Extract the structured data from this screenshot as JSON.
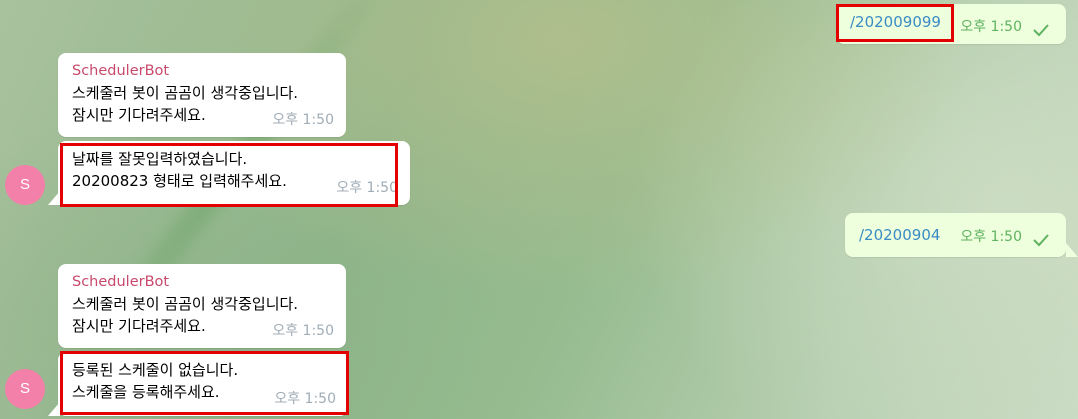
{
  "messages": [
    {
      "text": "/202009099",
      "time": "오후 1:50"
    },
    {
      "sender": "SchedulerBot",
      "text": "스케줄러 봇이 곰곰이 생각중입니다.\n잠시만 기다려주세요.",
      "time": "오후 1:50"
    },
    {
      "text": "날짜를 잘못입력하였습니다.\n20200823 형태로 입력해주세요.",
      "time": "오후 1:50"
    },
    {
      "text": "/20200904",
      "time": "오후 1:50"
    },
    {
      "sender": "SchedulerBot",
      "text": "스케줄러 봇이 곰곰이 생각중입니다.\n잠시만 기다려주세요.",
      "time": "오후 1:50"
    },
    {
      "text": "등록된 스케줄이 없습니다.\n스케줄을 등록해주세요.",
      "time": "오후 1:50"
    }
  ],
  "avatar_letter": "S",
  "colors": {
    "outgoing_bubble": "#eeffde",
    "incoming_bubble": "#ffffff",
    "sender_name": "#c8496c",
    "command_link": "#3a8cc4",
    "avatar": "#f380a8",
    "highlight": "#e30000",
    "check": "#5fb25f"
  },
  "icons": {
    "read_status": "check-icon"
  }
}
